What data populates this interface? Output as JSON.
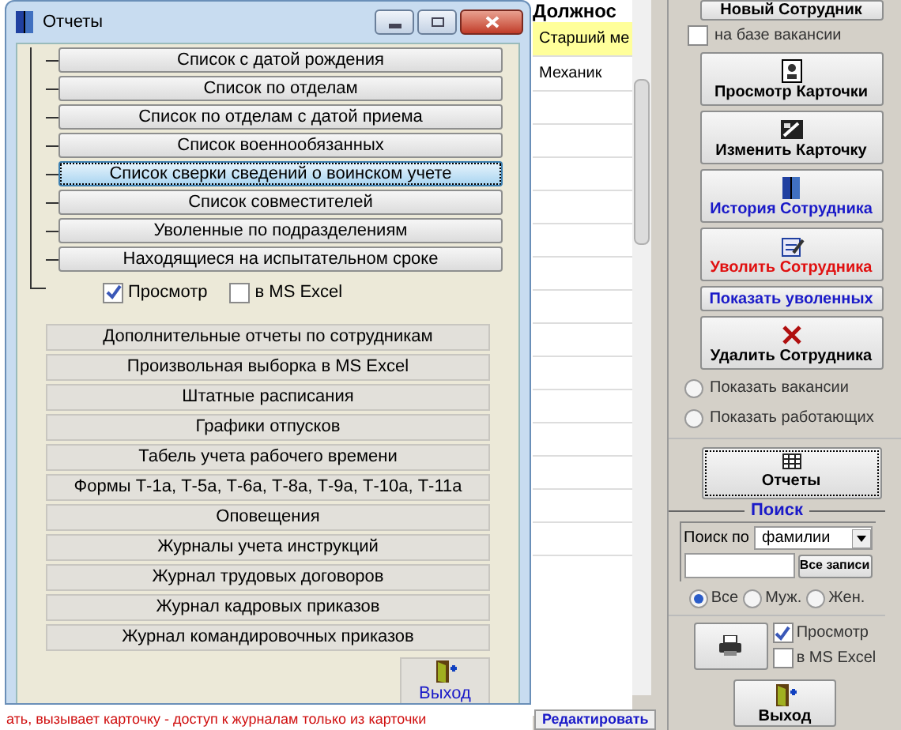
{
  "dialog": {
    "title": "Отчеты",
    "tree_buttons": [
      {
        "label": "Список с датой рождения",
        "selected": false
      },
      {
        "label": "Список по отделам",
        "selected": false
      },
      {
        "label": "Список по отделам с датой приема",
        "selected": false
      },
      {
        "label": "Список военнообязанных",
        "selected": false
      },
      {
        "label": "Список сверки сведений о воинском учете",
        "selected": true
      },
      {
        "label": "Список совместителей",
        "selected": false
      },
      {
        "label": "Уволенные по подразделениям",
        "selected": false
      },
      {
        "label": "Находящиеся на испытательном сроке",
        "selected": false
      }
    ],
    "options": [
      {
        "label": "Просмотр",
        "checked": true
      },
      {
        "label": "в MS Excel",
        "checked": false
      }
    ],
    "buttons": [
      "Дополнительные отчеты по сотрудникам",
      "Произвольная выборка в MS Excel",
      "Штатные расписания",
      "Графики отпусков",
      "Табель учета рабочего времени",
      "Формы Т-1а, Т-5а, Т-6а, Т-8а, Т-9а, Т-10а, Т-11а",
      "Оповещения",
      "Журналы учета инструкций",
      "Журнал трудовых договоров",
      "Журнал кадровых приказов",
      "Журнал командировочных приказов"
    ],
    "exit_button": "Выход"
  },
  "table": {
    "column": "Должнос",
    "rows": [
      {
        "cell": "Старший ме",
        "selected": true
      },
      {
        "cell": "Механик",
        "selected": false
      }
    ]
  },
  "bottom_link": "Редактировать",
  "status_text": "ать, вызывает карточку - доступ к журналам только из карточки",
  "panel": {
    "new_button": "Новый Сотрудник",
    "vacancy_option": {
      "label": "на базе вакансии",
      "checked": false
    },
    "actions": [
      {
        "label": "Просмотр Карточки",
        "kind": "card",
        "color": "#000000"
      },
      {
        "label": "Изменить Карточку",
        "kind": "edit",
        "color": "#000000"
      },
      {
        "label": "История Сотрудника",
        "kind": "book",
        "color": "#1a1ac8"
      },
      {
        "label": "Уволить Сотрудника",
        "kind": "note",
        "color": "#e01010"
      },
      {
        "label": "Показать уволенных",
        "kind": "plain",
        "color": "#1a1ac8"
      },
      {
        "label": "Удалить Сотрудника",
        "kind": "cross",
        "color": "#000000"
      }
    ],
    "show_options": [
      {
        "label": "Показать вакансии",
        "selected": false
      },
      {
        "label": "Показать работающих",
        "selected": false
      }
    ],
    "reports_button": "Отчеты",
    "search": {
      "title": "Поиск",
      "by_label": "Поиск по",
      "by_value": "фамилии",
      "all_button": "Все записи",
      "gender": [
        {
          "label": "Все",
          "selected": true
        },
        {
          "label": "Муж.",
          "selected": false
        },
        {
          "label": "Жен.",
          "selected": false
        }
      ]
    },
    "print_options": [
      {
        "label": "Просмотр",
        "checked": true
      },
      {
        "label": "в MS Excel",
        "checked": false
      }
    ],
    "exit_button": "Выход"
  }
}
